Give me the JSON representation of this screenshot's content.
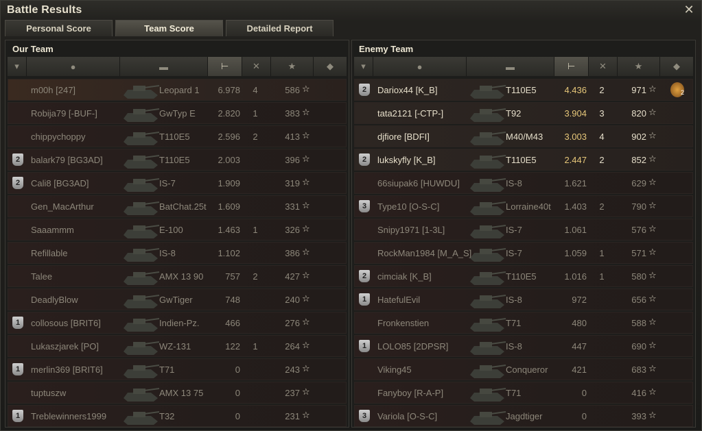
{
  "window": {
    "title": "Battle Results"
  },
  "tabs": [
    {
      "label": "Personal Score"
    },
    {
      "label": "Team Score"
    },
    {
      "label": "Detailed Report"
    }
  ],
  "our_team": {
    "title": "Our Team",
    "rows": [
      {
        "badge": "",
        "player": "m00h [247]",
        "tank": "Leopard 1",
        "damage": "6.978",
        "kills": "4",
        "xp": "586"
      },
      {
        "badge": "",
        "player": "Robija79 [-BUF-]",
        "tank": "GwTyp E",
        "damage": "2.820",
        "kills": "1",
        "xp": "383"
      },
      {
        "badge": "",
        "player": "chippychoppy",
        "tank": "T110E5",
        "damage": "2.596",
        "kills": "2",
        "xp": "413"
      },
      {
        "badge": "2",
        "player": "balark79 [BG3AD]",
        "tank": "T110E5",
        "damage": "2.003",
        "kills": "",
        "xp": "396"
      },
      {
        "badge": "2",
        "player": "Cali8 [BG3AD]",
        "tank": "IS-7",
        "damage": "1.909",
        "kills": "",
        "xp": "319"
      },
      {
        "badge": "",
        "player": "Gen_MacArthur",
        "tank": "BatChat.25t",
        "damage": "1.609",
        "kills": "",
        "xp": "331"
      },
      {
        "badge": "",
        "player": "Saaammm",
        "tank": "E-100",
        "damage": "1.463",
        "kills": "1",
        "xp": "326"
      },
      {
        "badge": "",
        "player": "Refillable",
        "tank": "IS-8",
        "damage": "1.102",
        "kills": "",
        "xp": "386"
      },
      {
        "badge": "",
        "player": "Talee",
        "tank": "AMX 13 90",
        "damage": "757",
        "kills": "2",
        "xp": "427"
      },
      {
        "badge": "",
        "player": "DeadlyBlow",
        "tank": "GwTiger",
        "damage": "748",
        "kills": "",
        "xp": "240"
      },
      {
        "badge": "1",
        "player": "collosous [BRIT6]",
        "tank": "Indien-Pz.",
        "damage": "466",
        "kills": "",
        "xp": "276"
      },
      {
        "badge": "",
        "player": "Lukaszjarek [PO]",
        "tank": "WZ-131",
        "damage": "122",
        "kills": "1",
        "xp": "264"
      },
      {
        "badge": "1",
        "player": "merlin369 [BRIT6]",
        "tank": "T71",
        "damage": "0",
        "kills": "",
        "xp": "243"
      },
      {
        "badge": "",
        "player": "tuptuszw",
        "tank": "AMX 13 75",
        "damage": "0",
        "kills": "",
        "xp": "237"
      },
      {
        "badge": "1",
        "player": "Treblewinners1999",
        "tank": "T32",
        "damage": "0",
        "kills": "",
        "xp": "231"
      }
    ]
  },
  "enemy_team": {
    "title": "Enemy Team",
    "rows": [
      {
        "badge": "2",
        "player": "Dariox44 [K_B]",
        "tank": "T110E5",
        "damage": "4.436",
        "kills": "2",
        "xp": "971",
        "alive": true,
        "medal": "2"
      },
      {
        "badge": "",
        "player": "tata2121 [-CTP-]",
        "tank": "T92",
        "damage": "3.904",
        "kills": "3",
        "xp": "820",
        "alive": true
      },
      {
        "badge": "",
        "player": "djfiore [BDFI]",
        "tank": "M40/M43",
        "damage": "3.003",
        "kills": "4",
        "xp": "902",
        "alive": true
      },
      {
        "badge": "2",
        "player": "lukskyfly [K_B]",
        "tank": "T110E5",
        "damage": "2.447",
        "kills": "2",
        "xp": "852",
        "alive": true
      },
      {
        "badge": "",
        "player": "66siupak6 [HUWDU]",
        "tank": "IS-8",
        "damage": "1.621",
        "kills": "",
        "xp": "629"
      },
      {
        "badge": "3",
        "player": "Type10 [O-S-C]",
        "tank": "Lorraine40t",
        "damage": "1.403",
        "kills": "2",
        "xp": "790"
      },
      {
        "badge": "",
        "player": "Snipy1971 [1-3L]",
        "tank": "IS-7",
        "damage": "1.061",
        "kills": "",
        "xp": "576"
      },
      {
        "badge": "",
        "player": "RockMan1984 [M_A_S]",
        "tank": "IS-7",
        "damage": "1.059",
        "kills": "1",
        "xp": "571"
      },
      {
        "badge": "2",
        "player": "cimciak [K_B]",
        "tank": "T110E5",
        "damage": "1.016",
        "kills": "1",
        "xp": "580"
      },
      {
        "badge": "1",
        "player": "HatefulEvil",
        "tank": "IS-8",
        "damage": "972",
        "kills": "",
        "xp": "656"
      },
      {
        "badge": "",
        "player": "Fronkenstien",
        "tank": "T71",
        "damage": "480",
        "kills": "",
        "xp": "588"
      },
      {
        "badge": "1",
        "player": "LOLO85 [2DPSR]",
        "tank": "IS-8",
        "damage": "447",
        "kills": "",
        "xp": "690"
      },
      {
        "badge": "",
        "player": "Viking45",
        "tank": "Conqueror",
        "damage": "421",
        "kills": "",
        "xp": "683"
      },
      {
        "badge": "",
        "player": "Fanyboy [R-A-P]",
        "tank": "T71",
        "damage": "0",
        "kills": "",
        "xp": "416"
      },
      {
        "badge": "3",
        "player": "Variola [O-S-C]",
        "tank": "Jagdtiger",
        "damage": "0",
        "kills": "",
        "xp": "393"
      }
    ]
  },
  "icons": {
    "close": "close-icon",
    "platoon": "platoon-icon",
    "player": "player-icon",
    "tank": "tank-icon",
    "damage": "damage-icon",
    "kills": "kills-icon",
    "xp": "star-icon",
    "medal": "medal-icon"
  },
  "colors": {
    "damage_gold": "#e6c77a",
    "row_red": "#2a1f1d"
  }
}
